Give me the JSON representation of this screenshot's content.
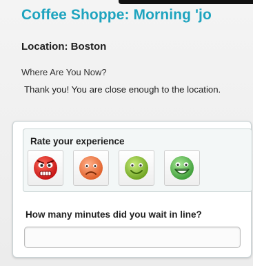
{
  "header": {
    "title": "Coffee Shoppe: Morning 'jo"
  },
  "location": {
    "label": "Location: Boston"
  },
  "status": {
    "question": "Where Are You Now?",
    "message": "Thank you! You are close enough to the location."
  },
  "rating": {
    "title": "Rate your experience",
    "options": [
      {
        "icon": "angry-face-icon",
        "color": "#e02828"
      },
      {
        "icon": "sad-face-icon",
        "color": "#f07a42"
      },
      {
        "icon": "happy-face-icon",
        "color": "#8fc43a"
      },
      {
        "icon": "grinning-face-icon",
        "color": "#5cc05a"
      }
    ]
  },
  "wait": {
    "label": "How many minutes did you wait in line?",
    "value": "",
    "placeholder": ""
  },
  "colors": {
    "accent": "#1ea4bf"
  }
}
